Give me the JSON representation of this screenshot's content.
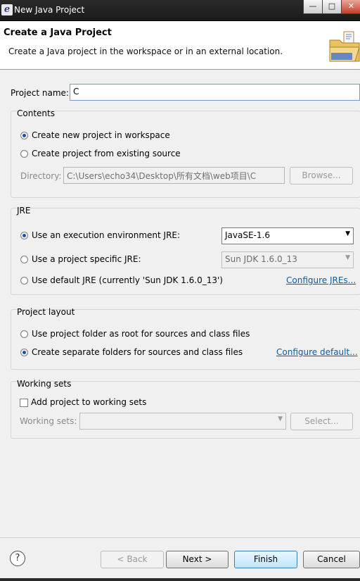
{
  "window": {
    "title": "New Java Project",
    "buttons": {
      "minimize": "—",
      "maximize": "□",
      "close": "✕"
    }
  },
  "header": {
    "title": "Create a Java Project",
    "description": "Create a Java project in the workspace or in an external location."
  },
  "project_name": {
    "label": "Project name:",
    "value": "C"
  },
  "contents": {
    "title": "Contents",
    "options": [
      {
        "label": "Create new project in workspace",
        "selected": true
      },
      {
        "label": "Create project from existing source",
        "selected": false
      }
    ],
    "directory_label": "Directory:",
    "directory_value": "C:\\Users\\echo34\\Desktop\\所有文档\\web项目\\C",
    "browse_label": "Browse..."
  },
  "jre": {
    "title": "JRE",
    "options": [
      {
        "label": "Use an execution environment JRE:",
        "selected": true
      },
      {
        "label": "Use a project specific JRE:",
        "selected": false
      },
      {
        "label": "Use default JRE (currently 'Sun JDK 1.6.0_13')",
        "selected": false
      }
    ],
    "environment_value": "JavaSE-1.6",
    "specific_value": "Sun JDK 1.6.0_13",
    "configure_link": "Configure JREs..."
  },
  "layout": {
    "title": "Project layout",
    "options": [
      {
        "label": "Use project folder as root for sources and class files",
        "selected": false
      },
      {
        "label": "Create separate folders for sources and class files",
        "selected": true
      }
    ],
    "configure_link": "Configure default..."
  },
  "working_sets": {
    "title": "Working sets",
    "add_label": "Add project to working sets",
    "add_checked": false,
    "sets_label": "Working sets:",
    "sets_value": "",
    "select_label": "Select..."
  },
  "footer": {
    "help": "?",
    "back": "< Back",
    "next": "Next >",
    "finish": "Finish",
    "cancel": "Cancel"
  },
  "colors": {
    "link": "#0b5cab",
    "titlebar": "#1f1f1f",
    "accent_radio": "#1c4fa8"
  }
}
